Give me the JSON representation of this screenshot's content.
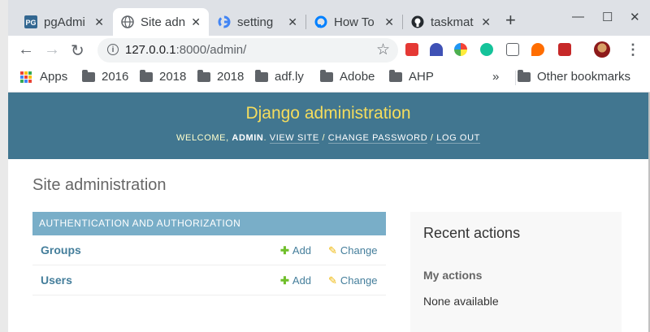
{
  "browser": {
    "tabs": [
      {
        "title": "pgAdmi",
        "icon": "pgadmin-icon",
        "active": false
      },
      {
        "title": "Site adn",
        "icon": "globe-icon",
        "active": true
      },
      {
        "title": "setting",
        "icon": "google-icon",
        "active": false
      },
      {
        "title": "How To",
        "icon": "digitalocean-icon",
        "active": false
      },
      {
        "title": "taskmat",
        "icon": "github-icon",
        "active": false
      }
    ],
    "address": {
      "host": "127.0.0.1",
      "path": ":8000/admin/"
    },
    "bookmarks": [
      "Apps",
      "2016",
      "2018",
      "2018",
      "adf.ly",
      "Adobe",
      "AHP"
    ],
    "other_bookmarks": "Other bookmarks",
    "overflow": "»"
  },
  "header": {
    "title": "Django administration",
    "welcome": "WELCOME,",
    "user": "ADMIN",
    "view_site": "VIEW SITE",
    "change_password": "CHANGE PASSWORD",
    "log_out": "LOG OUT"
  },
  "content": {
    "heading": "Site administration",
    "module": {
      "caption": "AUTHENTICATION AND AUTHORIZATION",
      "rows": [
        {
          "name": "Groups",
          "add": "Add",
          "change": "Change"
        },
        {
          "name": "Users",
          "add": "Add",
          "change": "Change"
        }
      ]
    }
  },
  "sidebar": {
    "title": "Recent actions",
    "subtitle": "My actions",
    "empty": "None available"
  },
  "colors": {
    "header_bg": "#417690",
    "title_yellow": "#f5dd5d",
    "caption_bg": "#79aec8",
    "link": "#447e9b"
  }
}
